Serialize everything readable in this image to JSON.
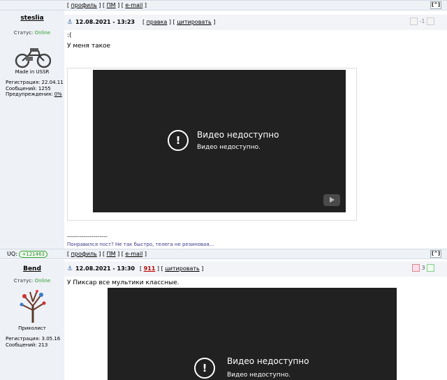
{
  "top_bar": {
    "profile": "профиль",
    "pm": "ПМ",
    "email": "e-mail",
    "up": "[^]"
  },
  "post1": {
    "author": "steslia",
    "status_label": "Статус:",
    "status_value": "Online",
    "avatar_caption": "Made in USSR",
    "stats": [
      "Регистрация: 22.04.11",
      "Сообщений: 1255"
    ],
    "warnings_label": "Предупреждения:",
    "warnings_value": "0%",
    "date": "12.08.2021 - 13:23",
    "edit": "правка",
    "quote": "цитировать",
    "vote_score": "-1",
    "line1": ":(",
    "line2": "У меня такое",
    "video_title": "Видео недоступно",
    "video_sub": "Видео недоступно.",
    "sig_sep": "--------------------",
    "signature": "Понравился пост? Не так быстро, телега не резиновая..."
  },
  "mid_bar": {
    "uq_label": "UQ:",
    "uq_value": "+121463",
    "profile": "профиль",
    "pm": "ПМ",
    "email": "e-mail",
    "up": "[^]"
  },
  "post2": {
    "author": "Bend",
    "status_label": "Статус:",
    "status_value": "Online",
    "avatar_caption": "Приколист",
    "stats": [
      "Регистрация: 3.05.16",
      "Сообщений: 213"
    ],
    "date": "12.08.2021 - 13:30",
    "reply_num": "911",
    "quote": "цитировать",
    "vote_score": "3",
    "line1": "У Пиксар все мультики классные.",
    "video_title": "Видео недоступно",
    "video_sub": "Видео недоступно."
  }
}
